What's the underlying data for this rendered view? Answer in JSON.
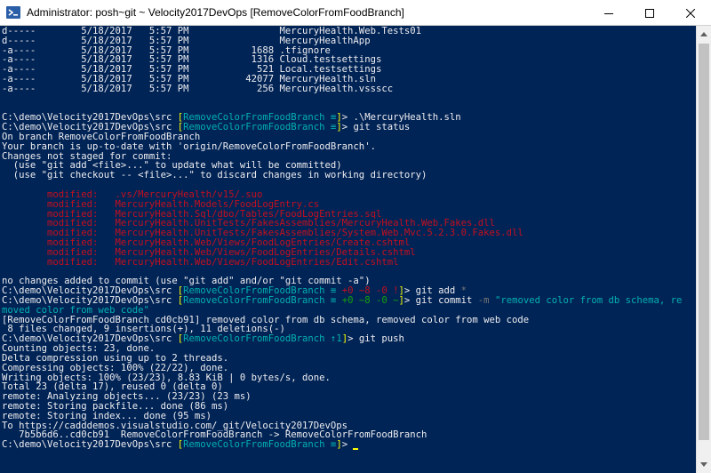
{
  "window": {
    "title": "Administrator: posh~git ~ Velocity2017DevOps [RemoveColorFromFoodBranch]",
    "buttons": [
      "minimize",
      "maximize",
      "close"
    ]
  },
  "colors": {
    "background": "#012456",
    "default": "#cccccc",
    "white": "#eeedf0",
    "yellow": "#ffff00",
    "cyan": "#00b0b0",
    "red": "#c50f1f",
    "green": "#13a10e",
    "gray": "#767676"
  },
  "console": {
    "lines": [
      {
        "segments": [
          {
            "text": "d-----        5/18/2017   5:57 PM                MercuryHealth.Web.Tests01",
            "color": "white"
          }
        ]
      },
      {
        "segments": [
          {
            "text": "d-----        5/18/2017   5:57 PM                MercuryHealthApp",
            "color": "white"
          }
        ]
      },
      {
        "segments": [
          {
            "text": "-a----        5/18/2017   5:57 PM           1688 .tfignore",
            "color": "white"
          }
        ]
      },
      {
        "segments": [
          {
            "text": "-a----        5/18/2017   5:57 PM           1316 Cloud.testsettings",
            "color": "white"
          }
        ]
      },
      {
        "segments": [
          {
            "text": "-a----        5/18/2017   5:57 PM            521 Local.testsettings",
            "color": "white"
          }
        ]
      },
      {
        "segments": [
          {
            "text": "-a----        5/18/2017   5:57 PM          42077 MercuryHealth.sln",
            "color": "white"
          }
        ]
      },
      {
        "segments": [
          {
            "text": "-a----        5/18/2017   5:57 PM            256 MercuryHealth.vssscc",
            "color": "white"
          }
        ]
      },
      {
        "segments": [
          {
            "text": "",
            "color": "white"
          }
        ]
      },
      {
        "segments": [
          {
            "text": "",
            "color": "white"
          }
        ]
      },
      {
        "segments": [
          {
            "text": "C:\\demo\\Velocity2017DevOps\\src ",
            "color": "white"
          },
          {
            "text": "[",
            "color": "yellow"
          },
          {
            "text": "RemoveColorFromFoodBranch ≡",
            "color": "cyan"
          },
          {
            "text": "]",
            "color": "yellow"
          },
          {
            "text": "> .\\MercuryHealth.sln",
            "color": "white"
          }
        ]
      },
      {
        "segments": [
          {
            "text": "C:\\demo\\Velocity2017DevOps\\src ",
            "color": "white"
          },
          {
            "text": "[",
            "color": "yellow"
          },
          {
            "text": "RemoveColorFromFoodBranch ≡",
            "color": "cyan"
          },
          {
            "text": "]",
            "color": "yellow"
          },
          {
            "text": "> git status",
            "color": "white"
          }
        ]
      },
      {
        "segments": [
          {
            "text": "On branch RemoveColorFromFoodBranch",
            "color": "white"
          }
        ]
      },
      {
        "segments": [
          {
            "text": "Your branch is up-to-date with 'origin/RemoveColorFromFoodBranch'.",
            "color": "white"
          }
        ]
      },
      {
        "segments": [
          {
            "text": "Changes not staged for commit:",
            "color": "white"
          }
        ]
      },
      {
        "segments": [
          {
            "text": "  (use \"git add <file>...\" to update what will be committed)",
            "color": "white"
          }
        ]
      },
      {
        "segments": [
          {
            "text": "  (use \"git checkout -- <file>...\" to discard changes in working directory)",
            "color": "white"
          }
        ]
      },
      {
        "segments": [
          {
            "text": "",
            "color": "white"
          }
        ]
      },
      {
        "segments": [
          {
            "text": "        modified:   .vs/MercuryHealth/v15/.suo",
            "color": "red"
          }
        ]
      },
      {
        "segments": [
          {
            "text": "        modified:   MercuryHealth.Models/FoodLogEntry.cs",
            "color": "red"
          }
        ]
      },
      {
        "segments": [
          {
            "text": "        modified:   MercuryHealth.Sql/dbo/Tables/FoodLogEntries.sql",
            "color": "red"
          }
        ]
      },
      {
        "segments": [
          {
            "text": "        modified:   MercuryHealth.UnitTests/FakesAssemblies/MercuryHealth.Web.Fakes.dll",
            "color": "red"
          }
        ]
      },
      {
        "segments": [
          {
            "text": "        modified:   MercuryHealth.UnitTests/FakesAssemblies/System.Web.Mvc.5.2.3.0.Fakes.dll",
            "color": "red"
          }
        ]
      },
      {
        "segments": [
          {
            "text": "        modified:   MercuryHealth.Web/Views/FoodLogEntries/Create.cshtml",
            "color": "red"
          }
        ]
      },
      {
        "segments": [
          {
            "text": "        modified:   MercuryHealth.Web/Views/FoodLogEntries/Details.cshtml",
            "color": "red"
          }
        ]
      },
      {
        "segments": [
          {
            "text": "        modified:   MercuryHealth.Web/Views/FoodLogEntries/Edit.cshtml",
            "color": "red"
          }
        ]
      },
      {
        "segments": [
          {
            "text": "",
            "color": "white"
          }
        ]
      },
      {
        "segments": [
          {
            "text": "no changes added to commit (use \"git add\" and/or \"git commit -a\")",
            "color": "white"
          }
        ]
      },
      {
        "segments": [
          {
            "text": "C:\\demo\\Velocity2017DevOps\\src ",
            "color": "white"
          },
          {
            "text": "[",
            "color": "yellow"
          },
          {
            "text": "RemoveColorFromFoodBranch ≡ ",
            "color": "cyan"
          },
          {
            "text": "+0 ~8 -0 !",
            "color": "red"
          },
          {
            "text": "]",
            "color": "yellow"
          },
          {
            "text": "> git add ",
            "color": "white"
          },
          {
            "text": "*",
            "color": "gray"
          }
        ]
      },
      {
        "segments": [
          {
            "text": "C:\\demo\\Velocity2017DevOps\\src ",
            "color": "white"
          },
          {
            "text": "[",
            "color": "yellow"
          },
          {
            "text": "RemoveColorFromFoodBranch ≡ ",
            "color": "cyan"
          },
          {
            "text": "+0 ~8 -0 ~",
            "color": "green"
          },
          {
            "text": "]",
            "color": "yellow"
          },
          {
            "text": "> git commit ",
            "color": "white"
          },
          {
            "text": "-m ",
            "color": "gray"
          },
          {
            "text": "\"removed color from db schema, re",
            "color": "cyan"
          }
        ]
      },
      {
        "segments": [
          {
            "text": "moved color from web code\"",
            "color": "cyan"
          }
        ]
      },
      {
        "segments": [
          {
            "text": "[RemoveColorFromFoodBranch cd0cb91] removed color from db schema, removed color from web code",
            "color": "white"
          }
        ]
      },
      {
        "segments": [
          {
            "text": " 8 files changed, 9 insertions(+), 11 deletions(-)",
            "color": "white"
          }
        ]
      },
      {
        "segments": [
          {
            "text": "C:\\demo\\Velocity2017DevOps\\src ",
            "color": "white"
          },
          {
            "text": "[",
            "color": "yellow"
          },
          {
            "text": "RemoveColorFromFoodBranch ↑1",
            "color": "cyan"
          },
          {
            "text": "]",
            "color": "yellow"
          },
          {
            "text": "> git push",
            "color": "white"
          }
        ]
      },
      {
        "segments": [
          {
            "text": "Counting objects: 23, done.",
            "color": "white"
          }
        ]
      },
      {
        "segments": [
          {
            "text": "Delta compression using up to 2 threads.",
            "color": "white"
          }
        ]
      },
      {
        "segments": [
          {
            "text": "Compressing objects: 100% (22/22), done.",
            "color": "white"
          }
        ]
      },
      {
        "segments": [
          {
            "text": "Writing objects: 100% (23/23), 8.83 KiB | 0 bytes/s, done.",
            "color": "white"
          }
        ]
      },
      {
        "segments": [
          {
            "text": "Total 23 (delta 17), reused 0 (delta 0)",
            "color": "white"
          }
        ]
      },
      {
        "segments": [
          {
            "text": "remote: Analyzing objects... (23/23) (23 ms)",
            "color": "white"
          }
        ]
      },
      {
        "segments": [
          {
            "text": "remote: Storing packfile... done (86 ms)",
            "color": "white"
          }
        ]
      },
      {
        "segments": [
          {
            "text": "remote: Storing index... done (95 ms)",
            "color": "white"
          }
        ]
      },
      {
        "segments": [
          {
            "text": "To https://cadddemos.visualstudio.com/_git/Velocity2017DevOps",
            "color": "white"
          }
        ]
      },
      {
        "segments": [
          {
            "text": "   7b5b6d6..cd0cb91  RemoveColorFromFoodBranch -> RemoveColorFromFoodBranch",
            "color": "white"
          }
        ]
      },
      {
        "segments": [
          {
            "text": "C:\\demo\\Velocity2017DevOps\\src ",
            "color": "white"
          },
          {
            "text": "[",
            "color": "yellow"
          },
          {
            "text": "RemoveColorFromFoodBranch ≡",
            "color": "cyan"
          },
          {
            "text": "]",
            "color": "yellow"
          },
          {
            "text": "> ",
            "color": "white"
          }
        ],
        "cursor": true
      }
    ]
  }
}
